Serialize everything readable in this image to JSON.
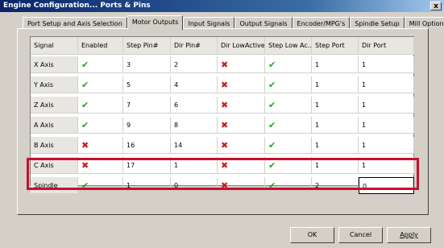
{
  "window": {
    "title": "Engine Configuration... Ports & Pins",
    "close_label": "x"
  },
  "tabs": [
    "Port Setup and Axis Selection",
    "Motor Outputs",
    "Input Signals",
    "Output Signals",
    "Encoder/MPG's",
    "Spindle Setup",
    "Mill Options"
  ],
  "active_tab": "Motor Outputs",
  "grid": {
    "headers": [
      "Signal",
      "Enabled",
      "Step Pin#",
      "Dir Pin#",
      "Dir LowActive",
      "Step Low Ac...",
      "Step Port",
      "Dir Port"
    ],
    "rows": [
      [
        "X Axis",
        "ok",
        "3",
        "2",
        "bad",
        "ok",
        "1",
        "1"
      ],
      [
        "Y Axis",
        "ok",
        "5",
        "4",
        "bad",
        "ok",
        "1",
        "1"
      ],
      [
        "Z Axis",
        "ok",
        "7",
        "6",
        "bad",
        "ok",
        "1",
        "1"
      ],
      [
        "A Axis",
        "ok",
        "9",
        "8",
        "bad",
        "ok",
        "1",
        "1"
      ],
      [
        "B Axis",
        "bad",
        "16",
        "14",
        "bad",
        "ok",
        "1",
        "1"
      ],
      [
        "C Axis",
        "bad",
        "17",
        "1",
        "bad",
        "ok",
        "1",
        "1"
      ],
      [
        "Spindle",
        "ok",
        "1",
        "0",
        "bad",
        "ok",
        "2",
        "0"
      ]
    ]
  },
  "buttons": {
    "ok": "OK",
    "cancel": "Cancel",
    "apply": "Apply"
  },
  "icons": {
    "ok": "green-check-icon",
    "bad": "red-x-icon"
  },
  "colors": {
    "highlight": "#c8102e",
    "check": "#1ea51e",
    "cross": "#c81e1e"
  }
}
